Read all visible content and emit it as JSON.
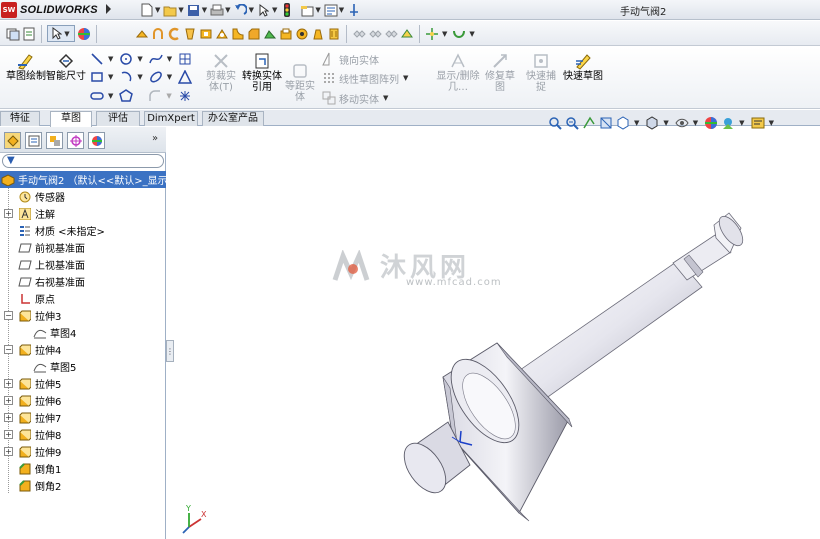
{
  "app": {
    "brand": "SOLIDWORKS",
    "badge": "SW",
    "window_title": "手动气阀2"
  },
  "cmd": {
    "big_buttons": [
      "草图绘制",
      "智能尺寸",
      "剪裁实体(T)",
      "转换实体引用",
      "等距实体",
      "显示/删除几…",
      "修复草图",
      "快速捕捉",
      "快速草图"
    ],
    "small_items": [
      "镜向实体",
      "线性草图阵列",
      "移动实体"
    ]
  },
  "tabs": [
    "特征",
    "草图",
    "评估",
    "DimXpert",
    "办公室产品"
  ],
  "tree": {
    "root": "手动气阀2 （默认<<默认>_显示",
    "items": [
      "传感器",
      "注解",
      "材质 <未指定>",
      "前视基准面",
      "上视基准面",
      "右视基准面",
      "原点",
      "拉伸3",
      "草图4",
      "拉伸4",
      "草图5",
      "拉伸5",
      "拉伸6",
      "拉伸7",
      "拉伸8",
      "拉伸9",
      "倒角1",
      "倒角2"
    ]
  },
  "watermark": {
    "text": "沐风网",
    "url": "www.mfcad.com"
  },
  "colors": {
    "selection": "#3b72c3",
    "brand": "#c8201f",
    "panel_border": "#9fb0c6"
  }
}
